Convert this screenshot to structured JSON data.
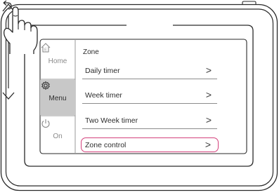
{
  "sidebar": {
    "items": [
      {
        "label": "Home",
        "icon": "home-icon"
      },
      {
        "label": "Menu",
        "icon": "gear-icon"
      },
      {
        "label": "On",
        "icon": "power-icon"
      }
    ]
  },
  "page": {
    "title": "Zone"
  },
  "menu": {
    "items": [
      {
        "label": "Daily timer"
      },
      {
        "label": "Week timer"
      },
      {
        "label": "Two Week timer"
      },
      {
        "label": "Zone control"
      }
    ]
  },
  "colors": {
    "highlight": "#d4417c",
    "active_tab": "#c8c8c8"
  }
}
